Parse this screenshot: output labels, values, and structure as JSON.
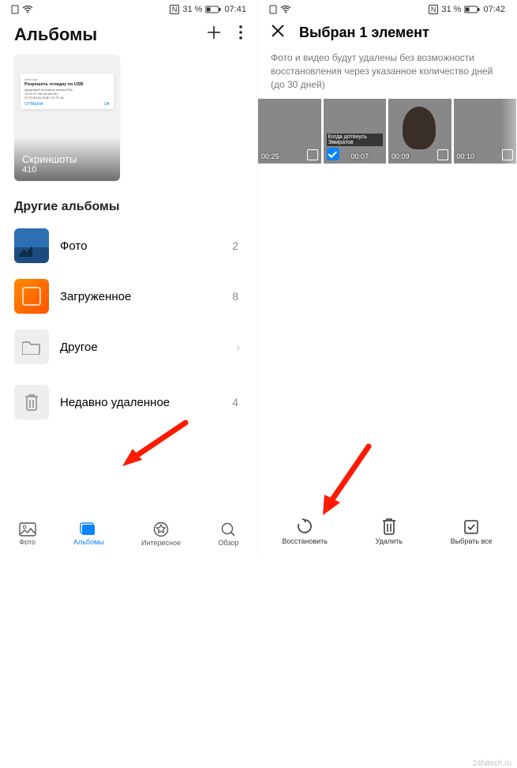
{
  "left": {
    "status": {
      "nfc": "N",
      "battery": "31 %",
      "time": "07:41"
    },
    "title": "Альбомы",
    "featured": {
      "dialog_title": "Разрешить отладку по USB",
      "dialog_cancel": "ОТМЕНА",
      "dialog_ok": "ОК",
      "name": "Скриншоты",
      "count": "410"
    },
    "section": "Другие альбомы",
    "rows": {
      "photo": {
        "label": "Фото",
        "count": "2"
      },
      "downloaded": {
        "label": "Загруженное",
        "count": "8"
      },
      "other": {
        "label": "Другое"
      },
      "deleted": {
        "label": "Недавно удаленное",
        "count": "4"
      }
    },
    "nav": {
      "photo": "Фото",
      "albums": "Альбомы",
      "interesting": "Интересное",
      "review": "Обзор"
    }
  },
  "right": {
    "status": {
      "nfc": "N",
      "battery": "31 %",
      "time": "07:42"
    },
    "title": "Выбран 1 элемент",
    "desc": "Фото и видео будут удалены без возможности восстановления через указанное количество дней (до 30 дней)",
    "items": {
      "d1": "00:25",
      "d2": "00:07",
      "cap2": "Когда дотянусь Эмиратов",
      "d3": "00:09",
      "d4": "00:10"
    },
    "actions": {
      "restore": "Восстановить",
      "delete": "Удалить",
      "selectall": "Выбрать все"
    }
  },
  "watermark": "24hitech.ru"
}
